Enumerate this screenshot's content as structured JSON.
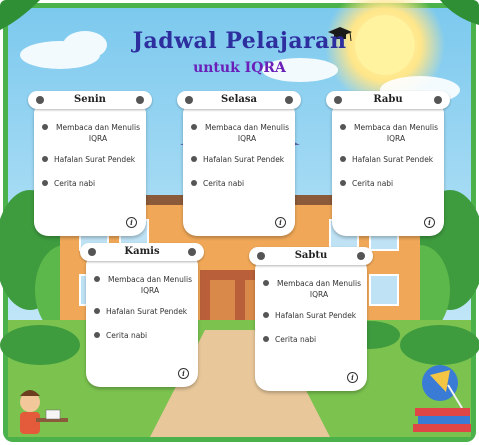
{
  "header": {
    "title": "Jadwal Pelajaran",
    "subtitle": "untuk IQRA"
  },
  "days": [
    {
      "name": "Senin",
      "items": [
        "Membaca dan Menulis IQRA",
        "Hafalan Surat Pendek",
        "Cerita nabi"
      ]
    },
    {
      "name": "Selasa",
      "items": [
        "Membaca dan Menulis IQRA",
        "Hafalan Surat Pendek",
        "Cerita nabi"
      ]
    },
    {
      "name": "Rabu",
      "items": [
        "Membaca dan Menulis IQRA",
        "Hafalan Surat Pendek",
        "Cerita nabi"
      ]
    },
    {
      "name": "Kamis",
      "items": [
        "Membaca dan Menulis IQRA",
        "Hafalan Surat Pendek",
        "Cerita nabi"
      ]
    },
    {
      "name": "Sabtu",
      "items": [
        "Membaca dan Menulis IQRA",
        "Hafalan Surat Pendek",
        "Cerita nabi"
      ]
    }
  ],
  "icons": {
    "info": "info-icon",
    "graduation_cap": "graduation-cap-icon",
    "bullet": "bullet-icon",
    "child": "student-reading-illustration",
    "lamp": "desk-lamp-illustration",
    "books": "books-illustration"
  },
  "colors": {
    "title": "#2e2f9e",
    "subtitle": "#6a1fb8",
    "frame": "#4bb24b",
    "sky": "#8fd3f0"
  }
}
